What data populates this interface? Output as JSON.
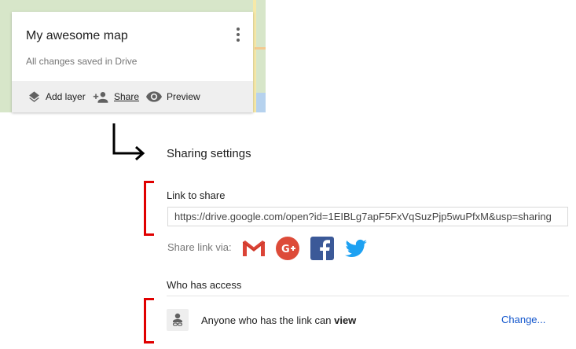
{
  "map_card": {
    "title": "My awesome map",
    "status": "All changes saved in Drive",
    "toolbar": {
      "add_layer": "Add layer",
      "share": "Share",
      "preview": "Preview"
    }
  },
  "sharing": {
    "title": "Sharing settings",
    "link_label": "Link to share",
    "link_value": "https://drive.google.com/open?id=1EIBLg7apF5FxVqSuzPjp5wuPfxM&usp=sharing",
    "share_via_label": "Share link via:",
    "social_icons": [
      "gmail-icon",
      "google-plus-icon",
      "facebook-icon",
      "twitter-icon"
    ],
    "access_label": "Who has access",
    "access_prefix": "Anyone who has the link can ",
    "access_level": "view",
    "change_link": "Change..."
  },
  "colors": {
    "bracket": "#e00000",
    "link": "#1155cc",
    "toolbar_bg": "#efefef",
    "gmail_red": "#db4437",
    "gplus_red": "#dd4b39",
    "facebook_blue": "#3b5998",
    "twitter_blue": "#1da1f2"
  }
}
